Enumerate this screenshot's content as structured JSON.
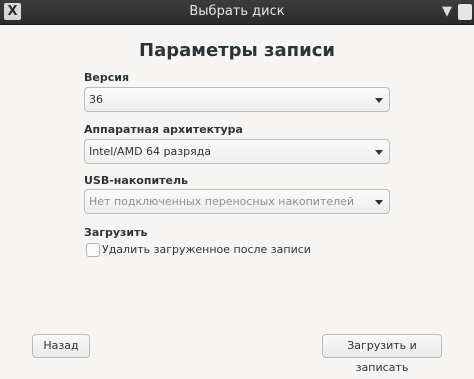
{
  "window": {
    "title": "Выбрать диск",
    "app_icon": "x-logo-icon",
    "close_glyph": "▼"
  },
  "main": {
    "heading": "Параметры записи",
    "version": {
      "label": "Версия",
      "value": "36"
    },
    "architecture": {
      "label": "Аппаратная архитектура",
      "value": "Intel/AMD 64 разряда"
    },
    "usb": {
      "label": "USB-накопитель",
      "placeholder": "Нет подключенных переносных накопителей"
    },
    "download": {
      "label": "Загрузить",
      "checkbox_label": "Удалить загруженное после записи",
      "checked": false
    }
  },
  "footer": {
    "back_label": "Назад",
    "download_write_label": "Загрузить и записать"
  }
}
